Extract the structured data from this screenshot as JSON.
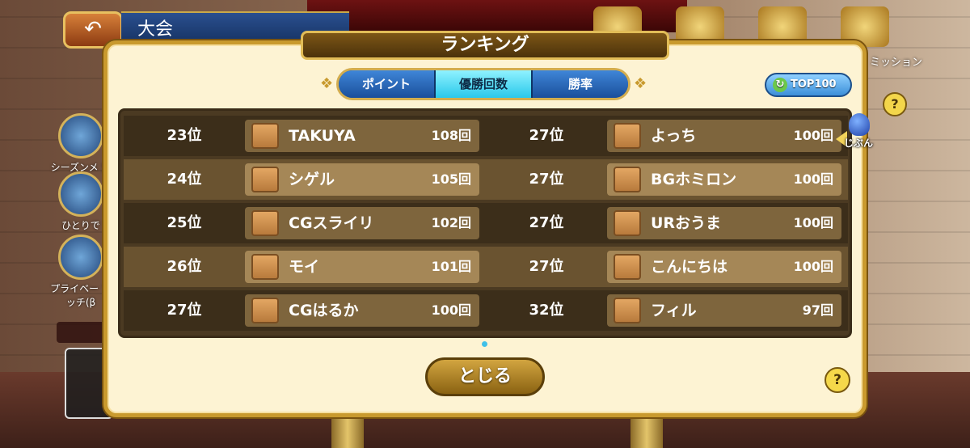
{
  "header": {
    "title": "大会",
    "back_icon": "back-arrow-icon"
  },
  "side_menu": [
    {
      "label": "シーズンメ 交換所"
    },
    {
      "label": "ひとりで"
    },
    {
      "label": "プライベー マッチ(β"
    }
  ],
  "top_menu": {
    "mission_label": "ミッション"
  },
  "modal": {
    "title": "ランキング",
    "tabs": [
      {
        "label": "ポイント",
        "active": false
      },
      {
        "label": "優勝回数",
        "active": true
      },
      {
        "label": "勝率",
        "active": false
      }
    ],
    "top100_label": "TOP100",
    "self_label": "じぶん",
    "close_label": "とじる",
    "help_label": "?"
  },
  "rankings_left": [
    {
      "rank": "23位",
      "name": "TAKUYA",
      "count": "108回"
    },
    {
      "rank": "24位",
      "name": "シゲル",
      "count": "105回"
    },
    {
      "rank": "25位",
      "name": "CGスライリ",
      "count": "102回"
    },
    {
      "rank": "26位",
      "name": "モイ",
      "count": "101回"
    },
    {
      "rank": "27位",
      "name": "CGはるか",
      "count": "100回"
    }
  ],
  "rankings_right": [
    {
      "rank": "27位",
      "name": "よっち",
      "count": "100回"
    },
    {
      "rank": "27位",
      "name": "BGホミロン",
      "count": "100回"
    },
    {
      "rank": "27位",
      "name": "URおうま",
      "count": "100回"
    },
    {
      "rank": "27位",
      "name": "こんにちは",
      "count": "100回"
    },
    {
      "rank": "32位",
      "name": "フィル",
      "count": "97回"
    }
  ],
  "colors": {
    "tab_active": "#2ac8ea",
    "frame_gold": "#c99a2e",
    "panel_bg": "#fdf3d3"
  }
}
